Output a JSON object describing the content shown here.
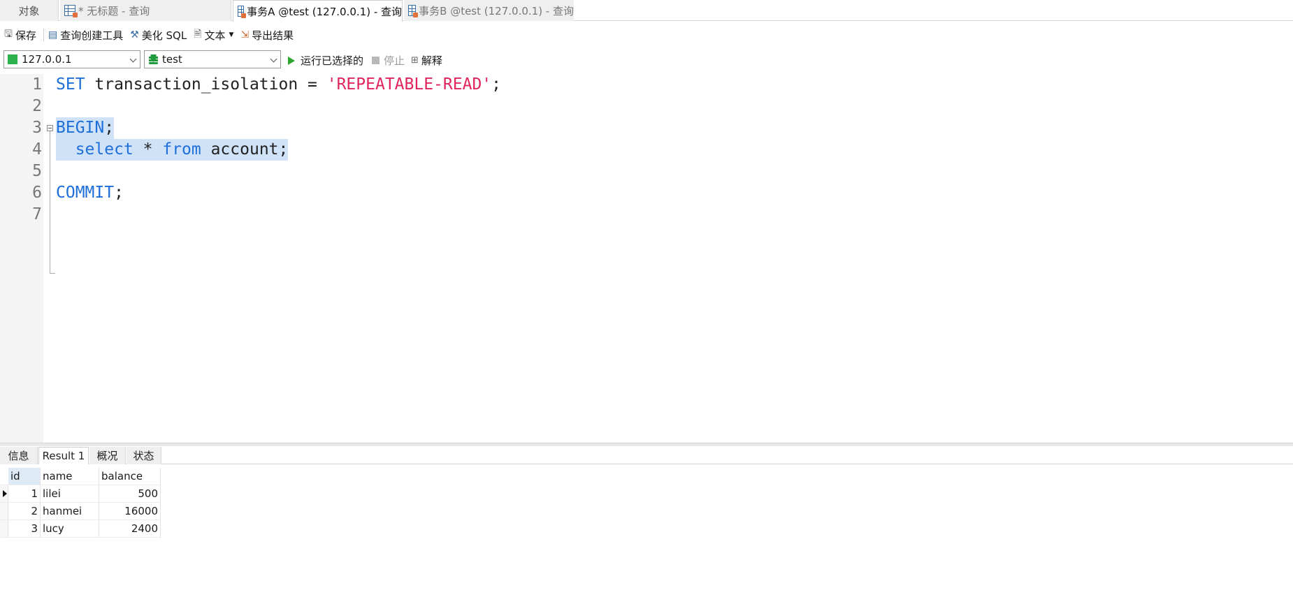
{
  "tabs": {
    "objects": "对象",
    "untitled": "* 无标题 - 查询",
    "tx_a": "事务A @test (127.0.0.1) - 查询",
    "tx_b": "事务B @test (127.0.0.1) - 查询"
  },
  "toolbar": {
    "save": "保存",
    "query_builder": "查询创建工具",
    "beautify": "美化 SQL",
    "text": "文本",
    "export": "导出结果"
  },
  "connection": {
    "host": "127.0.0.1",
    "database": "test",
    "run_selected": "运行已选择的",
    "stop": "停止",
    "explain": "解释"
  },
  "editor": {
    "lines": [
      {
        "num": "1",
        "tokens": [
          {
            "t": "SET",
            "c": "kw"
          },
          {
            "t": " transaction_isolation = ",
            "c": "plain"
          },
          {
            "t": "'REPEATABLE-READ'",
            "c": "str"
          },
          {
            "t": ";",
            "c": "plain"
          }
        ]
      },
      {
        "num": "2",
        "tokens": []
      },
      {
        "num": "3",
        "tokens": [
          {
            "t": "BEGIN",
            "c": "kw"
          },
          {
            "t": ";",
            "c": "plain"
          }
        ]
      },
      {
        "num": "4",
        "tokens": [
          {
            "t": "  ",
            "c": "plain"
          },
          {
            "t": "select",
            "c": "kw"
          },
          {
            "t": " * ",
            "c": "plain"
          },
          {
            "t": "from",
            "c": "kw"
          },
          {
            "t": " account;",
            "c": "plain"
          }
        ]
      },
      {
        "num": "5",
        "tokens": []
      },
      {
        "num": "6",
        "tokens": [
          {
            "t": "COMMIT",
            "c": "kw"
          },
          {
            "t": ";",
            "c": "plain"
          }
        ]
      },
      {
        "num": "7",
        "tokens": []
      }
    ]
  },
  "result_tabs": [
    "信息",
    "Result 1",
    "概况",
    "状态"
  ],
  "result": {
    "columns": [
      "id",
      "name",
      "balance"
    ],
    "rows": [
      [
        "1",
        "lilei",
        "500"
      ],
      [
        "2",
        "hanmei",
        "16000"
      ],
      [
        "3",
        "lucy",
        "2400"
      ]
    ]
  },
  "colors": {
    "keyword": "#1e6fd9",
    "string": "#e0245e",
    "selection": "#cfe2f8",
    "run": "#2ca52c"
  }
}
